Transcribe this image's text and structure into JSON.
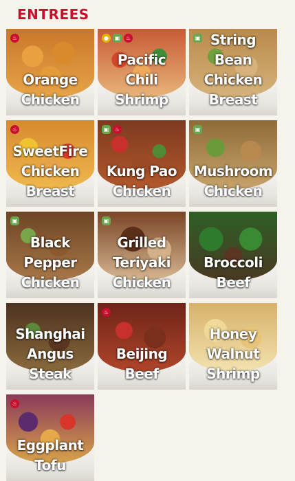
{
  "section": {
    "title": "ENTREES"
  },
  "colors": {
    "accent": "#c8102e",
    "background": "#f6f3ec"
  },
  "items": [
    {
      "label": "Orange\nChicken",
      "badges": [
        "hot"
      ],
      "food": "radial-gradient(circle at 30% 40%, #e8a040 0 14%, transparent 15%), radial-gradient(circle at 65% 35%, #d98a2b 0 15%, transparent 16%), radial-gradient(circle at 50% 70%, #e59b39 0 16%, transparent 17%), linear-gradient(#c9772a, #e7a447)"
    },
    {
      "label": "Pacific\nChili\nShrimp",
      "badges": [
        "wok",
        "veg",
        "hot"
      ],
      "food": "radial-gradient(circle at 25% 45%, #d2452b 0 10%, transparent 11%), radial-gradient(circle at 70% 40%, #3f8f3a 0 10%, transparent 11%), radial-gradient(circle at 50% 65%, #f0a95b 0 14%, transparent 15%), linear-gradient(#c85a35, #e8b57a)"
    },
    {
      "label": "String\nBean\nChicken\nBreast",
      "badges": [
        "veg"
      ],
      "food": "radial-gradient(circle at 30% 40%, #6fa03b 0 10%, transparent 11%), radial-gradient(circle at 65% 55%, #d7b27b 0 16%, transparent 17%), linear-gradient(#b98a4a, #d6b37d)"
    },
    {
      "label": "SweetFire\nChicken\nBreast",
      "badges": [
        "hot"
      ],
      "food": "radial-gradient(circle at 25% 40%, #f2c230 0 12%, transparent 13%), radial-gradient(circle at 70% 45%, #d93a2a 0 10%, transparent 11%), radial-gradient(circle at 50% 65%, #e6a34a 0 15%, transparent 16%), linear-gradient(#d68a2e, #f0b84e)"
    },
    {
      "label": "Kung Pao\nChicken",
      "badges": [
        "veg",
        "hot"
      ],
      "food": "radial-gradient(circle at 25% 35%, #c8312b 0 10%, transparent 11%), radial-gradient(circle at 70% 45%, #4f8a34 0 9%, transparent 10%), radial-gradient(circle at 50% 65%, #9a4a25 0 15%, transparent 16%), linear-gradient(#7d3a1f, #b3582c)"
    },
    {
      "label": "Mushroom\nChicken",
      "badges": [
        "veg"
      ],
      "food": "radial-gradient(circle at 30% 40%, #6b9a3a 0 12%, transparent 13%), radial-gradient(circle at 70% 45%, #b8894f 0 14%, transparent 15%), linear-gradient(#8f6b3a, #c7a36a)"
    },
    {
      "label": "Black\nPepper\nChicken",
      "badges": [
        "veg"
      ],
      "food": "radial-gradient(circle at 25% 35%, #7aa64a 0 9%, transparent 10%), radial-gradient(circle at 60% 50%, #8a5a2e 0 16%, transparent 17%), linear-gradient(#6d4424, #a77748)"
    },
    {
      "label": "Grilled\nTeriyaki\nChicken",
      "badges": [
        "veg"
      ],
      "food": "radial-gradient(circle at 40% 40%, #5a2e18 0 18%, transparent 19%), radial-gradient(circle at 70% 55%, #d3b08a 0 16%, transparent 17%), linear-gradient(#7a4526, #d5b690)"
    },
    {
      "label": "Broccoli\nBeef",
      "badges": [],
      "food": "radial-gradient(circle at 25% 40%, #2f7a2c 0 15%, transparent 16%), radial-gradient(circle at 70% 40%, #3a8a33 0 15%, transparent 16%), radial-gradient(circle at 50% 65%, #5a3520 0 14%, transparent 15%), linear-gradient(#2e5e26, #4a3a22)"
    },
    {
      "label": "Shanghai\nAngus\nSteak",
      "badges": [],
      "food": "radial-gradient(circle at 30% 40%, #5c8a3a 0 10%, transparent 11%), radial-gradient(circle at 60% 55%, #5a3520 0 16%, transparent 17%), linear-gradient(#4d3220, #8a6a3c)"
    },
    {
      "label": "Beijing\nBeef",
      "badges": [
        "hot"
      ],
      "food": "radial-gradient(circle at 30% 40%, #c8312b 0 11%, transparent 12%), radial-gradient(circle at 65% 50%, #7a2e1c 0 16%, transparent 17%), linear-gradient(#6e2418, #b0452a)"
    },
    {
      "label": "Honey\nWalnut\nShrimp",
      "badges": [],
      "food": "radial-gradient(circle at 30% 40%, #f1d99a 0 15%, transparent 16%), radial-gradient(circle at 70% 50%, #e8c47a 0 15%, transparent 16%), linear-gradient(#d7b26a, #f3e2b0)"
    },
    {
      "label": "Eggplant\nTofu",
      "badges": [
        "hot"
      ],
      "food": "radial-gradient(circle at 25% 40%, #5b2b6e 0 12%, transparent 13%), radial-gradient(circle at 70% 40%, #d7342a 0 10%, transparent 11%), radial-gradient(circle at 50% 65%, #e6a94a 0 15%, transparent 16%), linear-gradient(#8b3a5a, #d7a24a)"
    }
  ]
}
